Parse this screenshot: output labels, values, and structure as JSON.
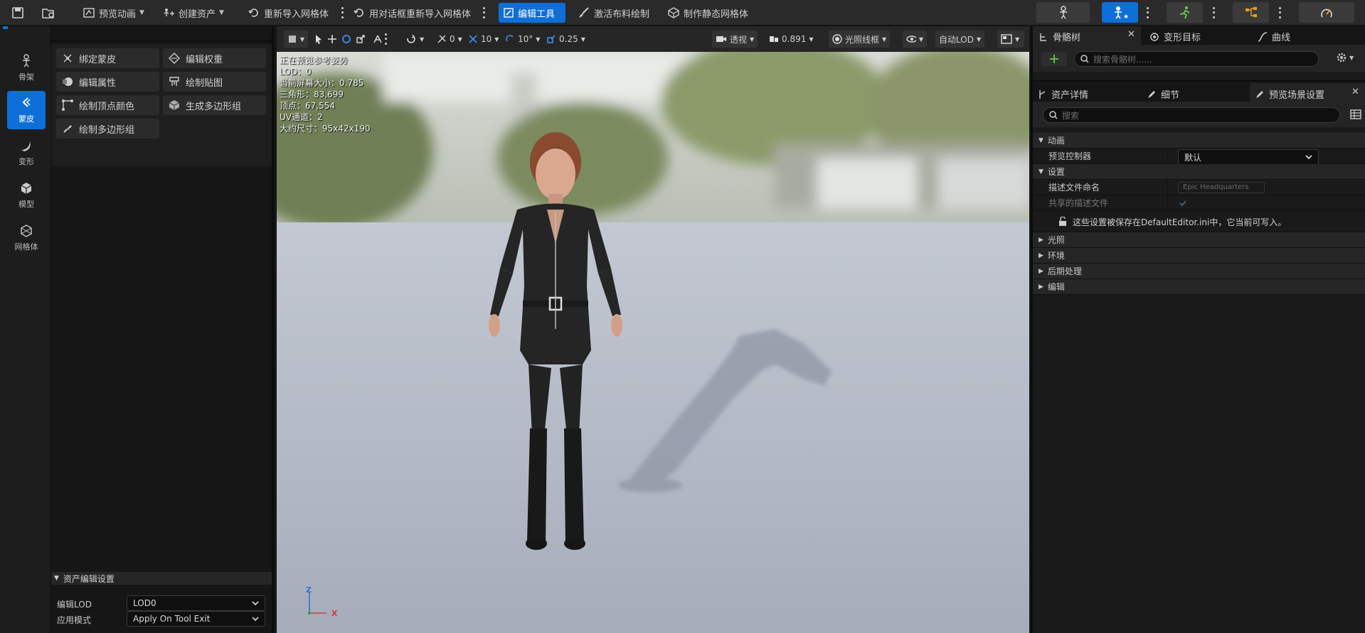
{
  "toolbar": {
    "preview_anim": "预览动画",
    "create_asset": "创建资产",
    "reimport_mesh": "重新导入网格体",
    "reimport_dialog": "用对话框重新导入网格体",
    "edit_tools": "编辑工具",
    "activate_cloth": "激活布料绘制",
    "make_static_mesh": "制作静态网格体"
  },
  "modes": [
    {
      "label": "骨架",
      "icon": "skeleton-icon"
    },
    {
      "label": "蒙皮",
      "icon": "skin-icon"
    },
    {
      "label": "变形",
      "icon": "deform-icon"
    },
    {
      "label": "模型",
      "icon": "model-icon"
    },
    {
      "label": "网格体",
      "icon": "mesh-icon"
    }
  ],
  "tools": [
    {
      "label": "绑定蒙皮",
      "icon": "bind-skin-icon"
    },
    {
      "label": "编辑权重",
      "icon": "edit-weights-icon"
    },
    {
      "label": "编辑属性",
      "icon": "edit-attributes-icon"
    },
    {
      "label": "绘制贴图",
      "icon": "paint-maps-icon"
    },
    {
      "label": "绘制顶点颜色",
      "icon": "paint-vertex-color-icon"
    },
    {
      "label": "生成多边形组",
      "icon": "generate-polygroups-icon"
    },
    {
      "label": "绘制多边形组",
      "icon": "paint-polygroups-icon"
    }
  ],
  "asset_settings": {
    "header": "资产编辑设置",
    "lod_label": "编辑LOD",
    "lod_value": "LOD0",
    "apply_label": "应用模式",
    "apply_value": "Apply On Tool Exit"
  },
  "viewport": {
    "snap_angle": "0",
    "grid": "10",
    "rot_snap": "10°",
    "scale_snap": "0.25",
    "perspective": "透视",
    "fov": "0.891",
    "lighting": "光照线框",
    "auto_lod": "自动LOD",
    "stats": [
      "正在预览参考姿势",
      "LOD：0",
      "当前屏幕大小：0.785",
      "三角形：83,699",
      "顶点：67,554",
      "UV通道：2",
      "大约尺寸：95x42x190"
    ],
    "axis_z": "Z",
    "axis_x": "X"
  },
  "right": {
    "tab_skeleton": "骨骼树",
    "tab_morph": "变形目标",
    "tab_curves": "曲线",
    "search_skeleton": "搜索骨骼树......",
    "tab_asset_details": "资产详情",
    "tab_details": "细节",
    "tab_preview_settings": "预览场景设置",
    "search": "搜索",
    "cat_anim": "动画",
    "preview_controller_label": "预览控制器",
    "preview_controller_value": "默认",
    "cat_settings": "设置",
    "profile_name_label": "描述文件命名",
    "profile_name_value": "Epic Headquarters",
    "shared_profile_label": "共享的描述文件",
    "info_text": "这些设置被保存在DefaultEditor.ini中，它当前可写入。",
    "cat_lighting": "光照",
    "cat_environment": "环境",
    "cat_postprocess": "后期处理",
    "cat_edit": "编辑"
  },
  "colors": {
    "accent": "#0e6fd8"
  }
}
